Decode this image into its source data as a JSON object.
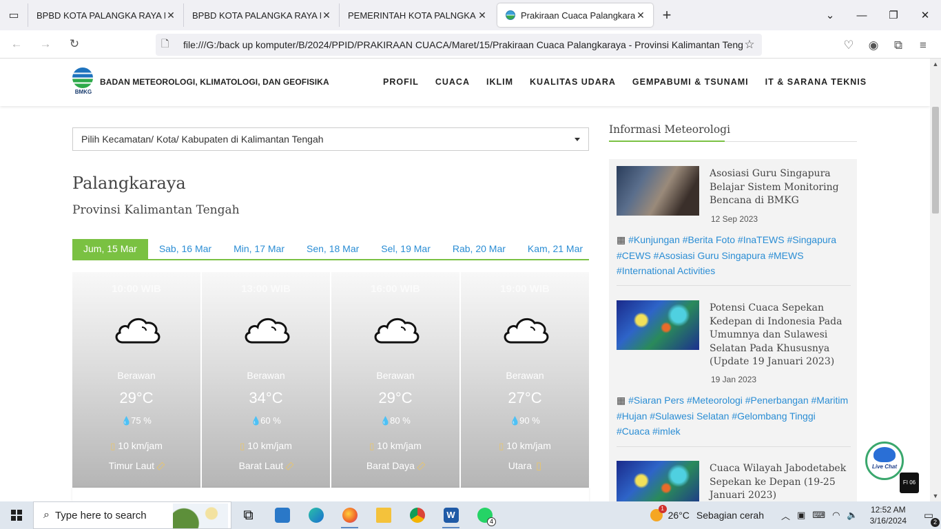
{
  "browser": {
    "tabs": [
      {
        "title": "BPBD KOTA PALANGKA RAYA MENY",
        "active": false
      },
      {
        "title": "BPBD KOTA PALANGKA RAYA MENY",
        "active": false
      },
      {
        "title": "PEMERINTAH KOTA PALNGKA RAYA",
        "active": false
      },
      {
        "title": "Prakiraan Cuaca Palangkaraya -",
        "active": true
      }
    ],
    "url": "file:///G:/back up komputer/B/2024/PPID/PRAKIRAAN CUACA/Maret/15/Prakiraan Cuaca Palangkaraya - Provinsi Kalimantan Tengah"
  },
  "site": {
    "logo_text": "BMKG",
    "org_name": "BADAN METEOROLOGI, KLIMATOLOGI, DAN GEOFISIKA",
    "menu": [
      "PROFIL",
      "CUACA",
      "IKLIM",
      "KUALITAS UDARA",
      "GEMPABUMI & TSUNAMI",
      "IT & SARANA TEKNIS"
    ]
  },
  "location": {
    "select_placeholder": "Pilih Kecamatan/ Kota/ Kabupaten di Kalimantan Tengah",
    "city": "Palangkaraya",
    "province": "Provinsi Kalimantan Tengah"
  },
  "days": [
    "Jum, 15 Mar",
    "Sab, 16 Mar",
    "Min, 17 Mar",
    "Sen, 18 Mar",
    "Sel, 19 Mar",
    "Rab, 20 Mar",
    "Kam, 21 Mar"
  ],
  "forecast": [
    {
      "time": "10:00 WIB",
      "icon": "cloud-icon",
      "desc": "Berawan",
      "temp": "29°C",
      "humidity": "75 %",
      "wind": "10 km/jam",
      "direction": "Timur Laut"
    },
    {
      "time": "13:00 WIB",
      "icon": "cloud-icon",
      "desc": "Berawan",
      "temp": "34°C",
      "humidity": "60 %",
      "wind": "10 km/jam",
      "direction": "Barat Laut"
    },
    {
      "time": "16:00 WIB",
      "icon": "cloud-icon",
      "desc": "Berawan",
      "temp": "29°C",
      "humidity": "80 %",
      "wind": "10 km/jam",
      "direction": "Barat Daya"
    },
    {
      "time": "19:00 WIB",
      "icon": "cloud-icon",
      "desc": "Berawan",
      "temp": "27°C",
      "humidity": "90 %",
      "wind": "10 km/jam",
      "direction": "Utara"
    }
  ],
  "sidebar": {
    "title": "Informasi Meteorologi",
    "news": [
      {
        "title": "Asosiasi Guru Singapura Belajar Sistem Monitoring Bencana di BMKG",
        "date": "12 Sep 2023",
        "tags": "#Kunjungan #Berita Foto #InaTEWS #Singapura #CEWS #Asosiasi Guru Singapura #MEWS #International Activities"
      },
      {
        "title": "Potensi Cuaca Sepekan Kedepan di Indonesia Pada Umumnya dan Sulawesi Selatan Pada Khususnya (Update 19 Januari 2023)",
        "date": "19 Jan 2023",
        "tags": "#Siaran Pers #Meteorologi #Penerbangan #Maritim #Hujan #Sulawesi Selatan #Gelombang Tinggi #Cuaca #imlek"
      },
      {
        "title": "Cuaca Wilayah Jabodetabek Sepekan ke Depan (19-25 Januari 2023)",
        "date": "",
        "tags": ""
      }
    ]
  },
  "widgets": {
    "livechat_text": "Live Chat",
    "toggle_text": "FI 06"
  },
  "taskbar": {
    "search_placeholder": "Type here to search",
    "whatsapp_badge": "4",
    "weather_temp": "26°C",
    "weather_desc": "Sebagian cerah",
    "time": "12:52 AM",
    "date": "3/16/2024",
    "notifications": "2"
  }
}
